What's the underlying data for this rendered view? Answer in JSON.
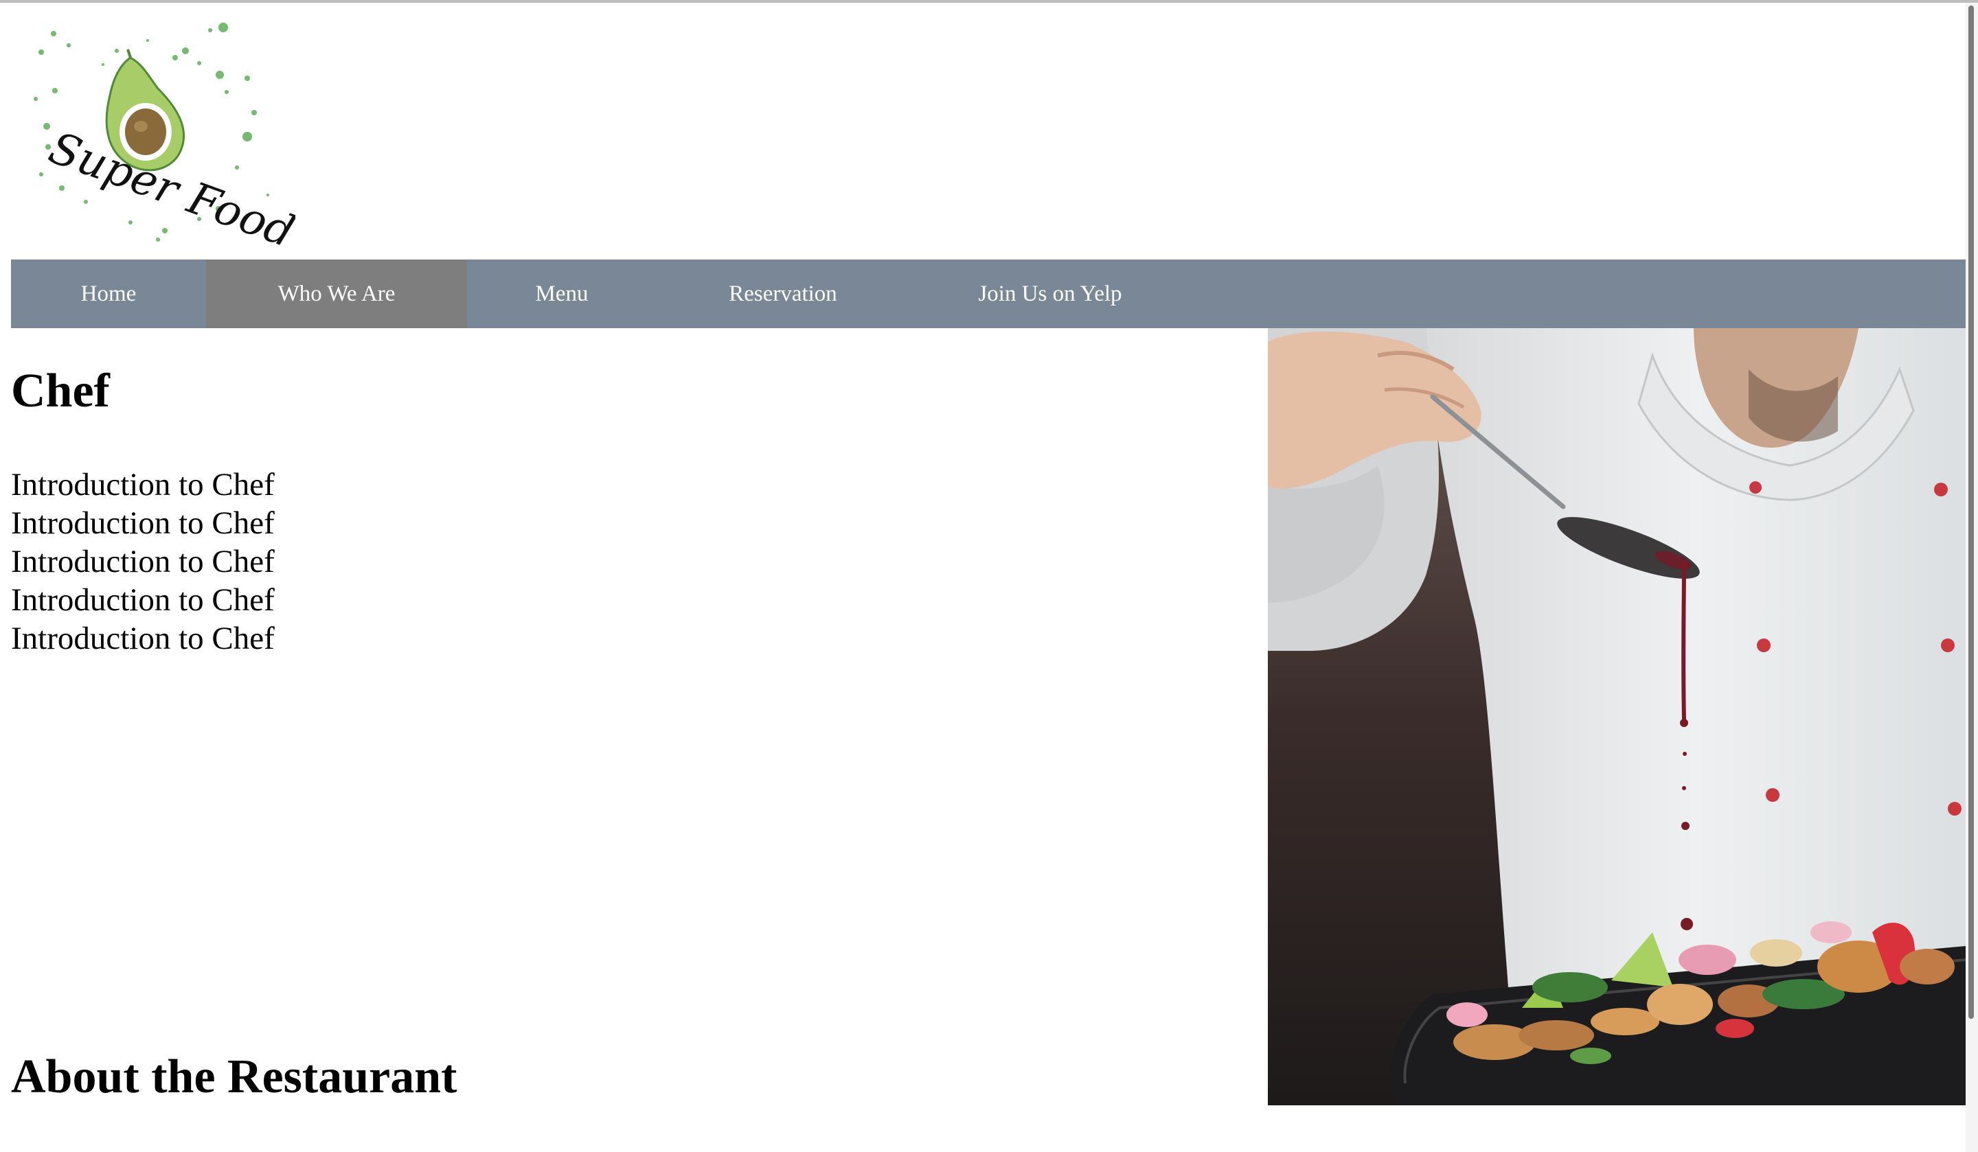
{
  "logo": {
    "text": "Super Food",
    "icon": "avocado-icon"
  },
  "nav": {
    "items": [
      {
        "label": "Home",
        "active": false
      },
      {
        "label": "Who We Are",
        "active": true
      },
      {
        "label": "Menu",
        "active": false
      },
      {
        "label": "Reservation",
        "active": false
      },
      {
        "label": "Join Us on Yelp",
        "active": false
      }
    ]
  },
  "chef": {
    "heading": "Chef",
    "lines": [
      "Introduction to Chef",
      "Introduction to Chef",
      "Introduction to Chef",
      "Introduction to Chef",
      "Introduction to Chef"
    ]
  },
  "about": {
    "heading": "About the Restaurant"
  },
  "colors": {
    "nav_bg": "#7a8796",
    "nav_active_bg": "#7e7e7e",
    "nav_text": "#ffffff"
  }
}
